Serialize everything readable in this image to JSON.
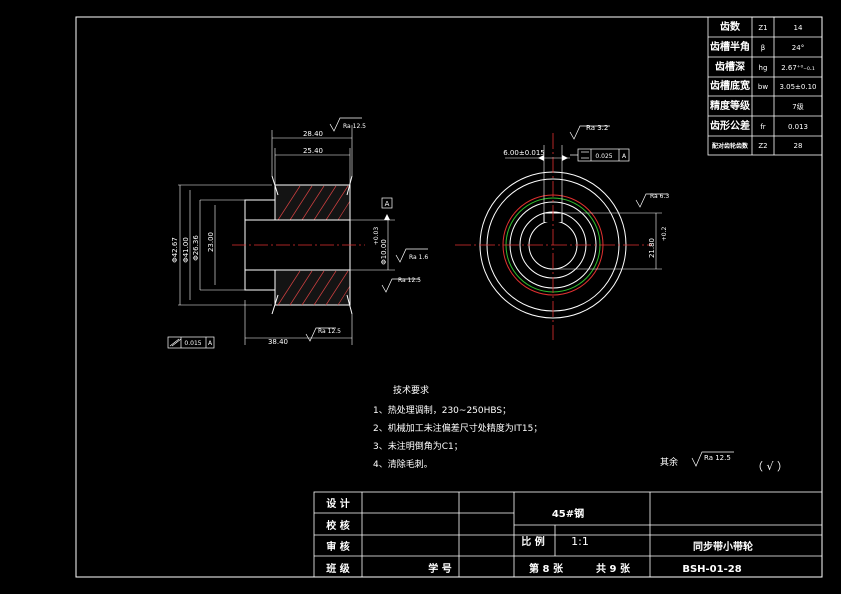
{
  "params": {
    "rows": [
      {
        "name": "齿数",
        "sym": "Z1",
        "val": "14"
      },
      {
        "name": "齿槽半角",
        "sym": "β",
        "val": "24°"
      },
      {
        "name": "齿槽深",
        "sym": "hg",
        "val": "2.67⁺⁰₋₀.₁"
      },
      {
        "name": "齿槽底宽",
        "sym": "bw",
        "val": "3.05±0.10"
      },
      {
        "name": "精度等级",
        "sym": "",
        "val": "7级"
      },
      {
        "name": "齿形公差",
        "sym": "fr",
        "val": "0.013"
      },
      {
        "name": "配对齿轮齿数",
        "sym": "Z2",
        "val": "28"
      }
    ]
  },
  "dims": {
    "w284": "28.40",
    "w254": "25.40",
    "w384": "38.40",
    "d42": "Φ42.67",
    "d41": "Φ41.00",
    "d26": "Φ26.36",
    "d23": "23.00",
    "d10": "Φ10.00",
    "tol03": "+0.03",
    "kw": "6.00±0.015",
    "kh": "21.80",
    "kh_tol": "+0.2",
    "datum": "A",
    "tol1": "0.025",
    "tol2": "0.015",
    "ra12": "Ra 12.5",
    "ra32": "Ra 3.2",
    "ra63": "Ra 6.3",
    "ra16": "Ra 1.6"
  },
  "notes": {
    "title": "技术要求",
    "items": [
      "1、热处理调制，230~250HBS；",
      "2、机械加工未注偏差尺寸处精度为IT15；",
      "3、未注明倒角为C1；",
      "4、清除毛刺。"
    ],
    "rest_label": "其余",
    "rest_ra": "Ra 12.5",
    "rest_mark": "（ √ ）"
  },
  "titleblock": {
    "design": "设 计",
    "check": "校 核",
    "review": "审 核",
    "class": "班 级",
    "student_no": "学 号",
    "material": "45#钢",
    "scale_label": "比 例",
    "scale": "1:1",
    "sheet": "第 8 张",
    "total": "共 9 张",
    "part_name": "同步带小带轮",
    "code": "BSH-01-28"
  }
}
